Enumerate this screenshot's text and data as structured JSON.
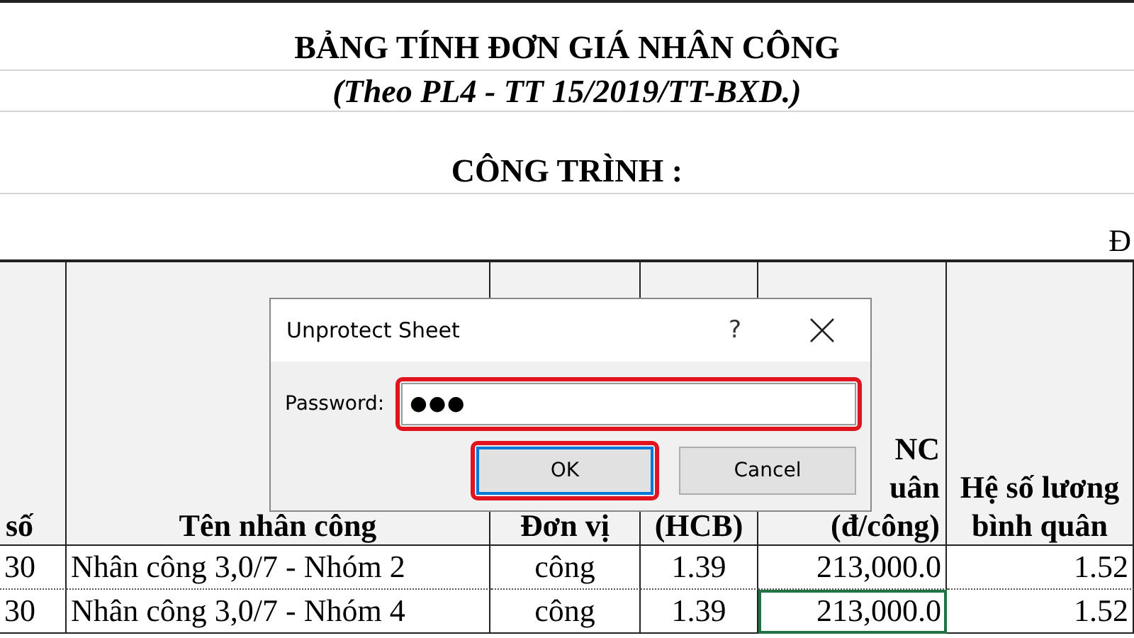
{
  "title": "BẢNG TÍNH ĐƠN GIÁ NHÂN CÔNG",
  "subtitle": "(Theo PL4 - TT 15/2019/TT-BXD.)",
  "project_label": "CÔNG TRÌNH :",
  "unit_note": "Đ",
  "table": {
    "columns": [
      {
        "lines": [
          "số"
        ]
      },
      {
        "lines": [
          "Tên nhân công"
        ]
      },
      {
        "lines": [
          "Đơn vị"
        ]
      },
      {
        "lines": [
          "(HCB)"
        ]
      },
      {
        "lines": [
          "NC",
          "uân",
          "(đ/công)"
        ]
      },
      {
        "lines": [
          "Hệ số lương",
          "bình quân"
        ]
      }
    ],
    "rows": [
      {
        "cells": [
          {
            "text": "30",
            "selected": false
          },
          {
            "text": "Nhân công 3,0/7 - Nhóm 2",
            "selected": false
          },
          {
            "text": "công",
            "selected": false
          },
          {
            "text": "1.39",
            "selected": false
          },
          {
            "text": "213,000.0",
            "selected": false
          },
          {
            "text": "1.52",
            "selected": false
          }
        ]
      },
      {
        "cells": [
          {
            "text": "30",
            "selected": false
          },
          {
            "text": "Nhân công 3,0/7 - Nhóm 4",
            "selected": false
          },
          {
            "text": "công",
            "selected": false
          },
          {
            "text": "1.39",
            "selected": false
          },
          {
            "text": "213,000.0",
            "selected": true
          },
          {
            "text": "1.52",
            "selected": false
          }
        ]
      }
    ]
  },
  "dialog": {
    "title": "Unprotect Sheet",
    "help": "?",
    "password_label": "Password:",
    "password_value": "●●●",
    "field_highlighted": true,
    "buttons": [
      {
        "label": "OK",
        "default": true,
        "highlighted": true
      },
      {
        "label": "Cancel",
        "default": false,
        "highlighted": false
      }
    ]
  }
}
